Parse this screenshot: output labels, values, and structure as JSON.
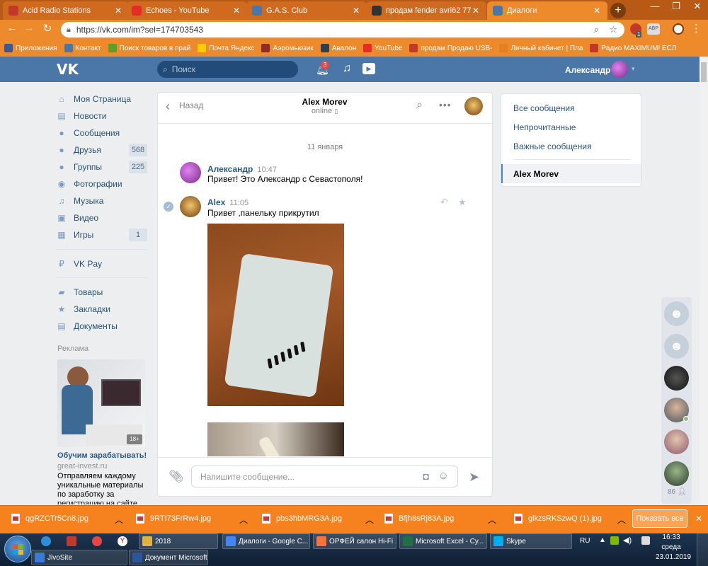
{
  "browser": {
    "tabs": [
      {
        "label": "Acid Radio Stations",
        "favicon_color": "#c0392b"
      },
      {
        "label": "Echoes - YouTube",
        "favicon_color": "#e52d27"
      },
      {
        "label": "G.A.S. Club",
        "favicon_color": "#4a76a8"
      },
      {
        "label": "продам fender avri62 77гр пр",
        "favicon_color": "#333333"
      },
      {
        "label": "Диалоги",
        "favicon_color": "#4a76a8"
      }
    ],
    "url": "https://vk.com/im?sel=174703543",
    "bookmarks": [
      {
        "label": "Приложения",
        "color": "#3b5998"
      },
      {
        "label": "Контакт",
        "color": "#4a76a8"
      },
      {
        "label": "Поиск товаров в прай",
        "color": "#5aa02c"
      },
      {
        "label": "Почта Яндекс",
        "color": "#ffcc00"
      },
      {
        "label": "Аэромьюзик",
        "color": "#8e2b2b"
      },
      {
        "label": "Авалон",
        "color": "#2c3e50"
      },
      {
        "label": "YouTube",
        "color": "#e52d27"
      },
      {
        "label": "продам Продаю USB-",
        "color": "#c0392b"
      },
      {
        "label": "Личный кабинет | Пла",
        "color": "#e67e22"
      },
      {
        "label": "Радио MAXIMUM! ЕСЛ",
        "color": "#c0392b"
      }
    ],
    "extension_badge": "1"
  },
  "vk": {
    "search_placeholder": "Поиск",
    "notifications_count": "3",
    "user_name": "Александр",
    "menu": [
      {
        "label": "Моя Страница",
        "icon": "home-icon",
        "glyph": "⌂",
        "count": ""
      },
      {
        "label": "Новости",
        "icon": "news-icon",
        "glyph": "▤",
        "count": ""
      },
      {
        "label": "Сообщения",
        "icon": "messages-icon",
        "glyph": "●",
        "count": ""
      },
      {
        "label": "Друзья",
        "icon": "friends-icon",
        "glyph": "●",
        "count": "568"
      },
      {
        "label": "Группы",
        "icon": "groups-icon",
        "glyph": "●",
        "count": "225"
      },
      {
        "label": "Фотографии",
        "icon": "photo-icon",
        "glyph": "◉",
        "count": ""
      },
      {
        "label": "Музыка",
        "icon": "music-icon",
        "glyph": "♫",
        "count": ""
      },
      {
        "label": "Видео",
        "icon": "video-icon",
        "glyph": "▣",
        "count": ""
      },
      {
        "label": "Игры",
        "icon": "games-icon",
        "glyph": "▦",
        "count": "1"
      },
      {
        "label": "VK Pay",
        "icon": "vkpay-icon",
        "glyph": "₽",
        "count": ""
      },
      {
        "label": "Товары",
        "icon": "goods-icon",
        "glyph": "▰",
        "count": ""
      },
      {
        "label": "Закладки",
        "icon": "bookmarks-icon",
        "glyph": "★",
        "count": ""
      },
      {
        "label": "Документы",
        "icon": "documents-icon",
        "glyph": "▤",
        "count": ""
      }
    ],
    "ads": {
      "heading": "Реклама",
      "title": "Обучим зарабатывать!",
      "domain": "great-invest.ru",
      "text": "Отправляем каждому уникальные материалы по заработку за регистрацию на сайте",
      "age": "18+"
    },
    "chat": {
      "back_label": "Назад",
      "contact_name": "Alex Morev",
      "status": "online",
      "date_divider": "11 января",
      "messages": [
        {
          "author": "Александр",
          "time": "10:47",
          "text": "Привет! Это Александр с Севастополя!"
        },
        {
          "author": "Alex",
          "time": "11:05",
          "text": "Привет ,панельку прикрутил"
        }
      ],
      "input_placeholder": "Напишите сообщение..."
    },
    "filters": {
      "all": "Все сообщения",
      "unread": "Непрочитанные",
      "important": "Важные сообщения",
      "selected_contact": "Alex Morev"
    },
    "online_count": "86"
  },
  "downloads": {
    "items": [
      "qgRZCTr5Cn8.jpg",
      "9RTI73FrRw4.jpg",
      "pbs3hbMRG3A.jpg",
      "Bfjh8sRj83A.jpg",
      "glkzsRKSzwQ (1).jpg"
    ],
    "show_all": "Показать все"
  },
  "taskbar": {
    "row1": [
      {
        "label": "2018",
        "color": "#e3b23c"
      },
      {
        "label": "Диалоги - Google C...",
        "color": "#4285f4"
      },
      {
        "label": "ОРФЕЙ салон Hi-Fi ...",
        "color": "#ff7139"
      },
      {
        "label": "Microsoft Excel - Су...",
        "color": "#1d7044"
      },
      {
        "label": "Skype",
        "color": "#00aff0"
      }
    ],
    "row2": [
      {
        "label": "JivoSite",
        "color": "#3a7bd5"
      },
      {
        "label": "Документ Microsoft ...",
        "color": "#2b579a"
      }
    ],
    "lang": "RU",
    "time": "16:33",
    "weekday": "среда",
    "date": "23.01.2019"
  }
}
